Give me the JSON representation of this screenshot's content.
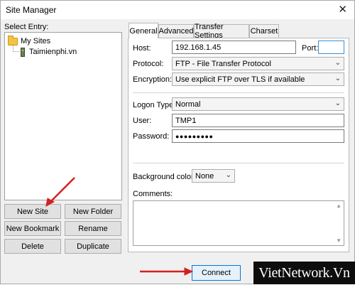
{
  "window": {
    "title": "Site Manager",
    "close_glyph": "✕"
  },
  "entry_label": "Select Entry:",
  "tree": {
    "root": "My Sites",
    "child": "Taimienphi.vn",
    "root_icon": "folder-icon",
    "child_icon": "server-icon"
  },
  "left_buttons": {
    "new_site": "New Site",
    "new_folder": "New Folder",
    "new_bookmark": "New Bookmark",
    "rename": "Rename",
    "delete": "Delete",
    "duplicate": "Duplicate"
  },
  "tabs": [
    "General",
    "Advanced",
    "Transfer Settings",
    "Charset"
  ],
  "general": {
    "host_label": "Host:",
    "host_value": "192.168.1.45",
    "port_label": "Port:",
    "port_value": "",
    "protocol_label": "Protocol:",
    "protocol_value": "FTP - File Transfer Protocol",
    "encryption_label": "Encryption:",
    "encryption_value": "Use explicit FTP over TLS if available",
    "logon_label": "Logon Type:",
    "logon_value": "Normal",
    "user_label": "User:",
    "user_value": "TMP1",
    "password_label": "Password:",
    "password_value": "●●●●●●●●●",
    "bgcolor_label": "Background color:",
    "bgcolor_value": "None",
    "comments_label": "Comments:"
  },
  "bottom": {
    "connect": "Connect"
  },
  "watermark": "VietNetwork.Vn",
  "colors": {
    "arrow": "#d42020",
    "window_bg": "#f0f0f0"
  }
}
